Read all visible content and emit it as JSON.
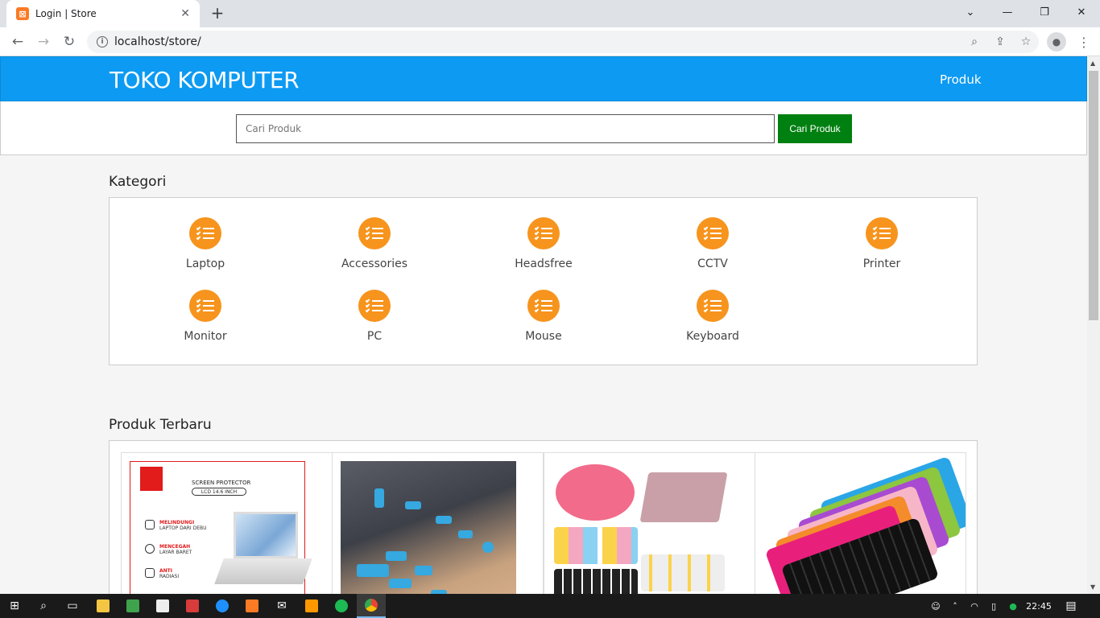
{
  "browser": {
    "tab_title": "Login | Store",
    "tab_close": "✕",
    "new_tab": "+",
    "url": "localhost/store/",
    "window_controls": {
      "chevron": "⌄",
      "minimize": "—",
      "restore": "❐",
      "close": "✕"
    }
  },
  "header": {
    "brand": "TOKO KOMPUTER",
    "nav_link": "Produk"
  },
  "search": {
    "placeholder": "Cari Produk",
    "button_label": "Cari Produk"
  },
  "kategori": {
    "title": "Kategori",
    "items": [
      "Laptop",
      "Accessories",
      "Headsfree",
      "CCTV",
      "Printer",
      "Monitor",
      "PC",
      "Mouse",
      "Keyboard"
    ]
  },
  "produk": {
    "title": "Produk Terbaru",
    "product1": {
      "heading": "SCREEN PROTECTOR",
      "pill": "LCD 14.6 INCH",
      "features": [
        {
          "title": "MELINDUNGI",
          "sub": "LAPTOP DARI DEBU"
        },
        {
          "title": "MENCEGAH",
          "sub": "LAYAR BARET"
        },
        {
          "title": "ANTI",
          "sub": "RADIASI"
        }
      ]
    }
  },
  "taskbar": {
    "clock": "22:45"
  },
  "colors": {
    "header_blue": "#0d9af2",
    "search_button_green": "#008010",
    "category_icon_orange": "#f7941d"
  }
}
